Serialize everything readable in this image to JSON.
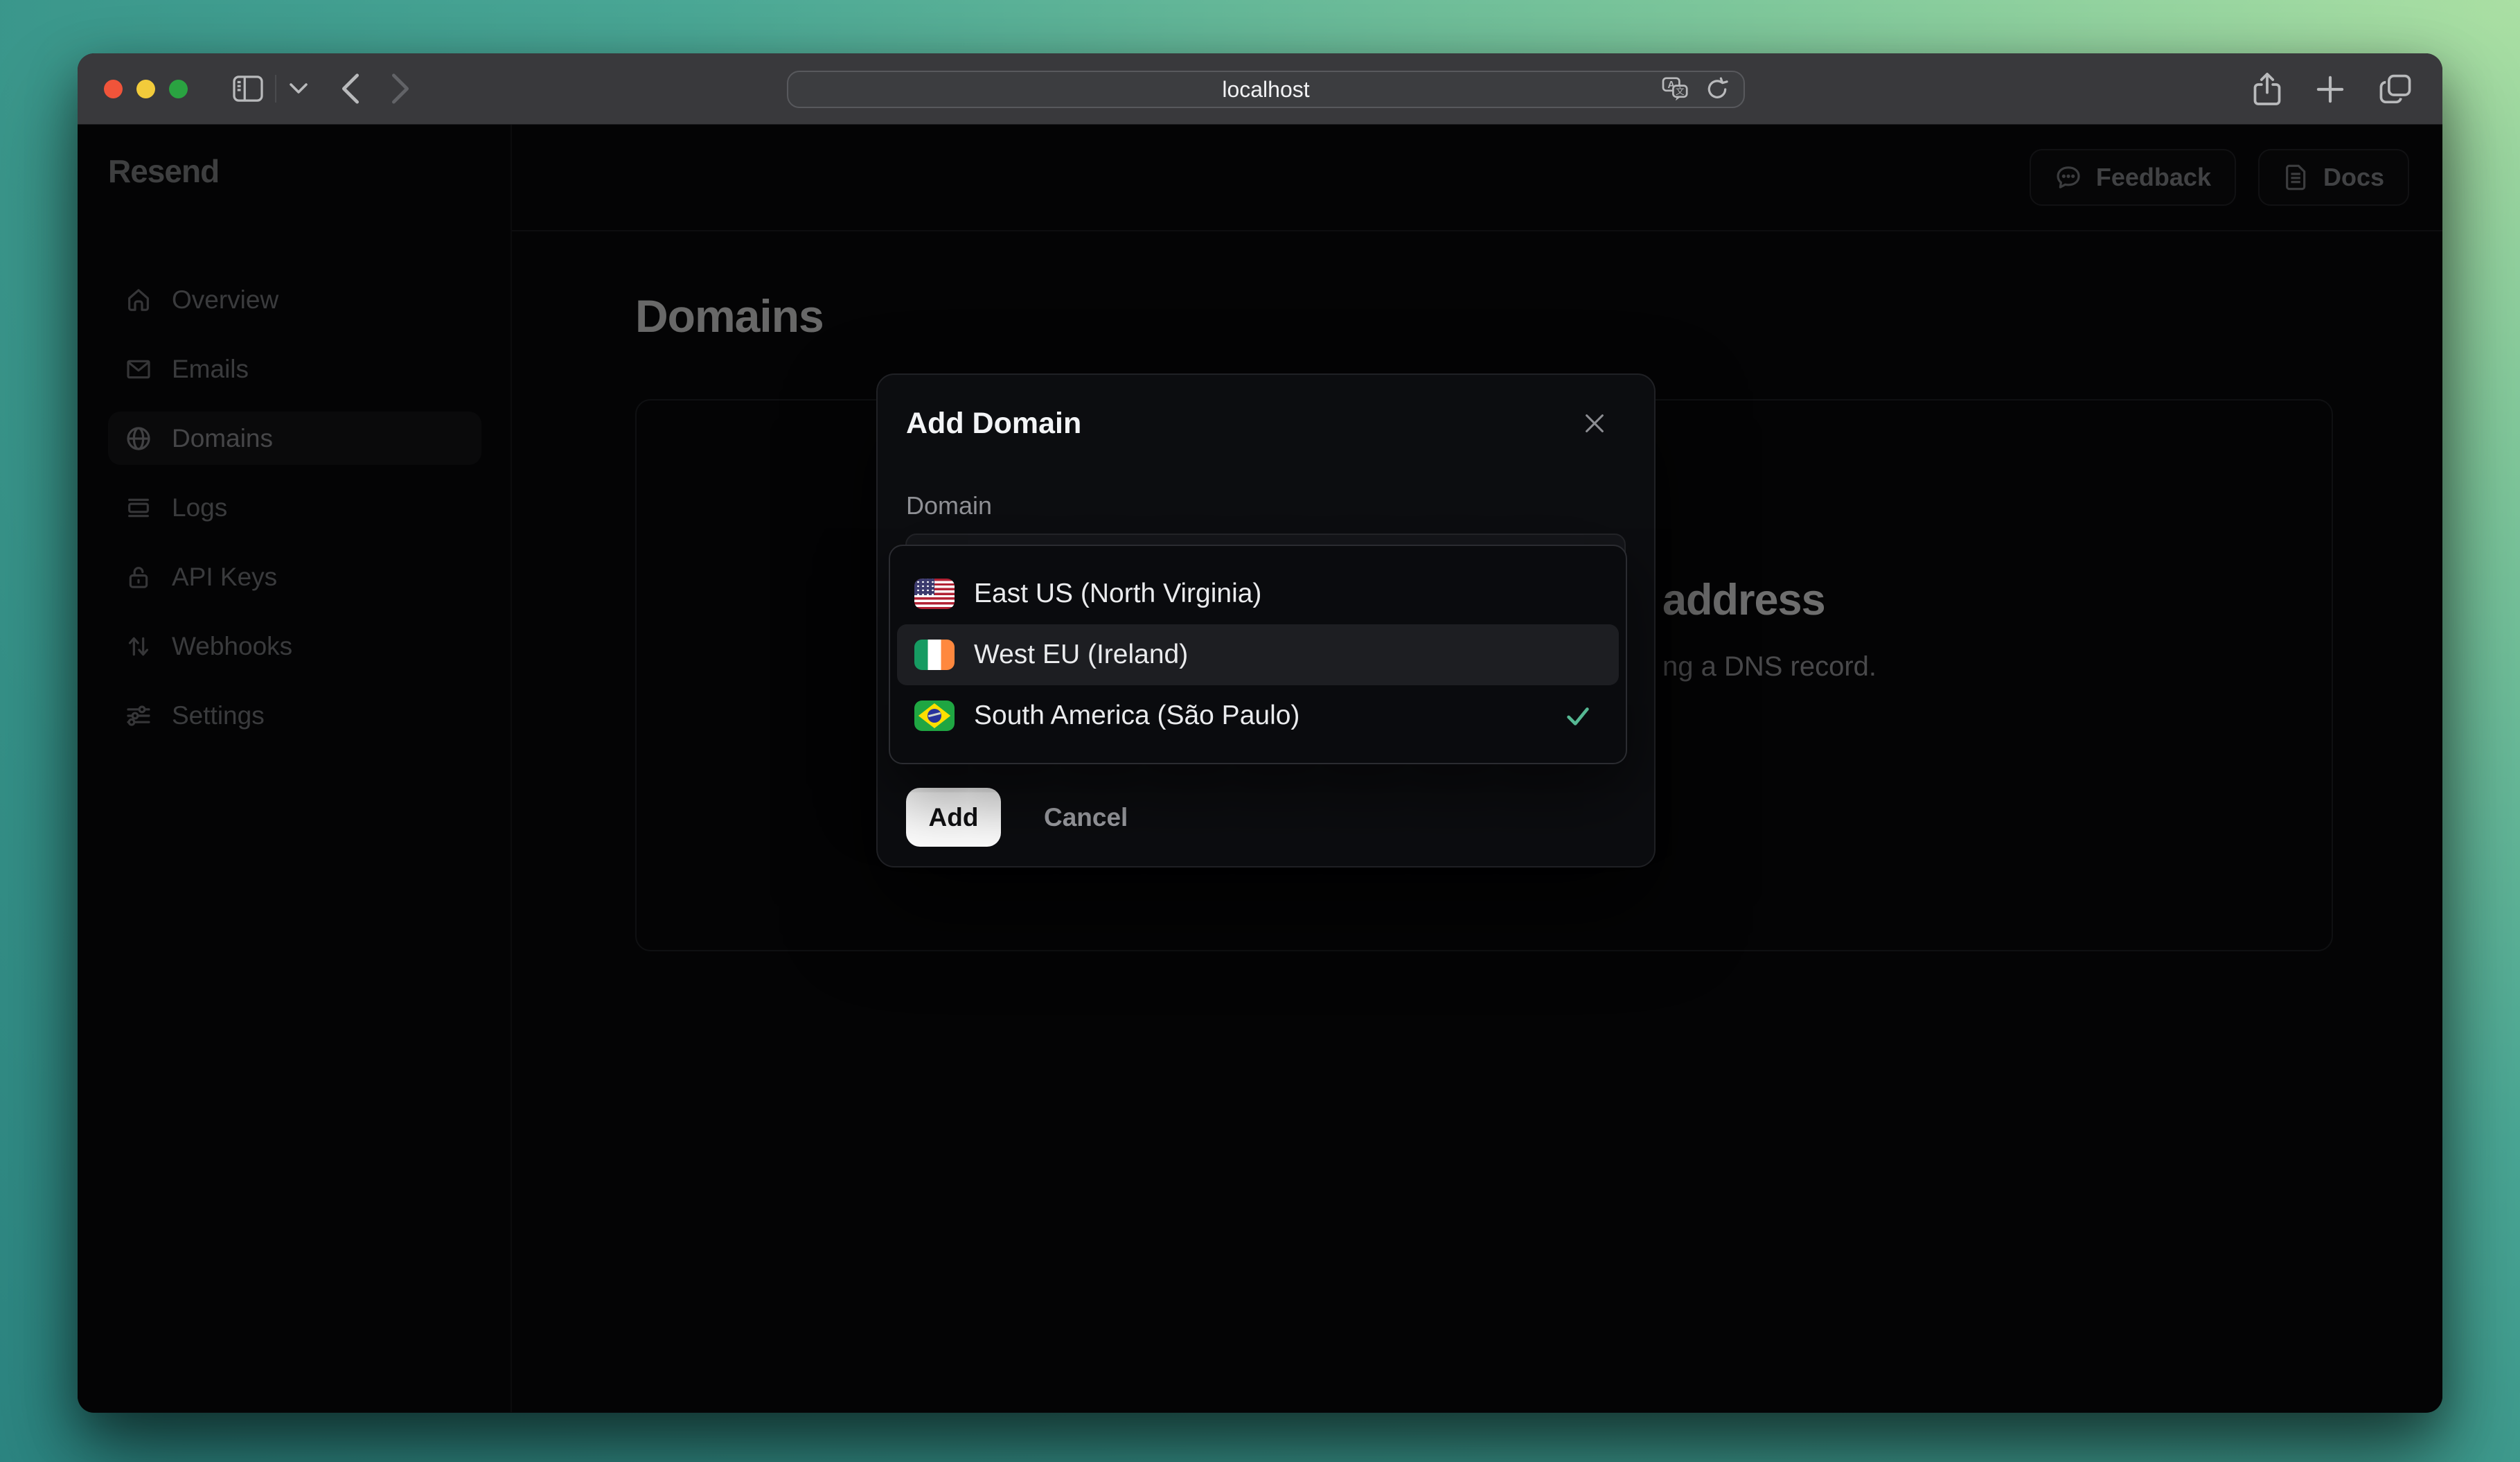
{
  "browser": {
    "url": "localhost",
    "icons": [
      "close",
      "minimize",
      "zoom",
      "sidebar-toggle-icon",
      "chevron-down-icon",
      "back-icon",
      "forward-icon",
      "shield-icon",
      "translate-icon",
      "reload-icon",
      "share-icon",
      "new-tab-icon",
      "tab-overview-icon"
    ]
  },
  "sidebar": {
    "logo": "Resend",
    "items": [
      {
        "label": "Overview",
        "icon": "home-icon",
        "active": false
      },
      {
        "label": "Emails",
        "icon": "mail-icon",
        "active": false
      },
      {
        "label": "Domains",
        "icon": "globe-icon",
        "active": true
      },
      {
        "label": "Logs",
        "icon": "logs-icon",
        "active": false
      },
      {
        "label": "API Keys",
        "icon": "lock-icon",
        "active": false
      },
      {
        "label": "Webhooks",
        "icon": "webhooks-icon",
        "active": false
      },
      {
        "label": "Settings",
        "icon": "settings-icon",
        "active": false
      }
    ]
  },
  "header": {
    "feedback_label": "Feedback",
    "docs_label": "Docs"
  },
  "page": {
    "title": "Domains",
    "card": {
      "heading_fragment": "address",
      "body_fragment": "ng a DNS record."
    }
  },
  "modal": {
    "title": "Add Domain",
    "field_label": "Domain",
    "add_label": "Add",
    "cancel_label": "Cancel"
  },
  "dropdown": {
    "options": [
      {
        "label": "East US (North Virginia)",
        "flag": "us-flag",
        "selected": false,
        "highlighted": false
      },
      {
        "label": "West EU (Ireland)",
        "flag": "ireland-flag",
        "selected": false,
        "highlighted": true
      },
      {
        "label": "South America (São Paulo)",
        "flag": "brazil-flag",
        "selected": true,
        "highlighted": false
      }
    ]
  },
  "colors": {
    "check_accent": "#56b893",
    "add_button_bg": "#ffffff",
    "highlight_row": "#1d1e22",
    "traffic_red": "#f0543a",
    "traffic_yellow": "#f2cb3b",
    "traffic_green": "#2aa341"
  }
}
